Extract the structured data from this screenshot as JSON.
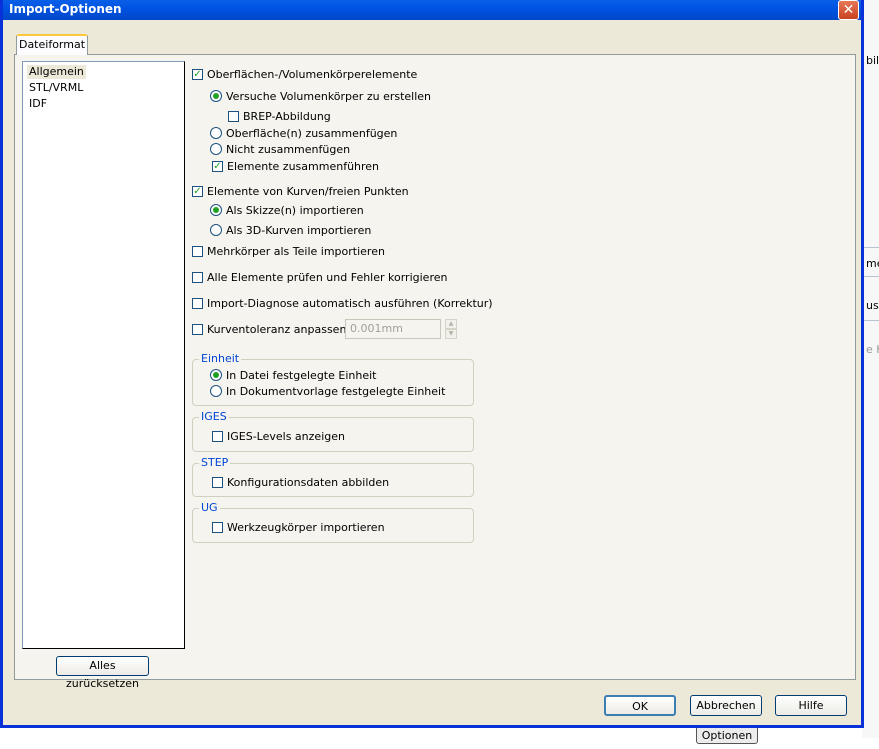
{
  "window": {
    "title": "Import-Optionen",
    "close_glyph": "✕"
  },
  "tabs": [
    {
      "label": "Dateiformat"
    }
  ],
  "sidebar": {
    "items": [
      {
        "label": "Allgemein",
        "selected": true
      },
      {
        "label": "STL/VRML",
        "selected": false
      },
      {
        "label": "IDF",
        "selected": false
      }
    ],
    "reset_button": "Alles zurücksetzen"
  },
  "options": {
    "surfaces": {
      "label": "Oberflächen-/Volumenkörperelemente",
      "checked": true
    },
    "try_solids": {
      "label": "Versuche Volumenkörper zu erstellen",
      "selected": true
    },
    "brep": {
      "label": "BREP-Abbildung",
      "checked": false
    },
    "knit_surfaces": {
      "label": "Oberfläche(n) zusammenfügen",
      "selected": false
    },
    "no_knit": {
      "label": "Nicht zusammenfügen",
      "selected": false
    },
    "merge_entities": {
      "label": "Elemente zusammenführen",
      "checked": true
    },
    "curves": {
      "label": "Elemente von Kurven/freien Punkten",
      "checked": true
    },
    "as_sketches": {
      "label": "Als Skizze(n) importieren",
      "selected": true
    },
    "as_3d_curves": {
      "label": "Als 3D-Kurven importieren",
      "selected": false
    },
    "multibody": {
      "label": "Mehrkörper als Teile importieren",
      "checked": false
    },
    "check_all": {
      "label": "Alle Elemente prüfen und Fehler korrigieren",
      "checked": false
    },
    "import_diag": {
      "label": "Import-Diagnose automatisch ausführen (Korrektur)",
      "checked": false
    },
    "curve_tolerance": {
      "label": "Kurventoleranz anpassen:",
      "checked": false,
      "value": "0.001mm"
    }
  },
  "groups": {
    "units": {
      "legend": "Einheit",
      "file_unit": {
        "label": "In Datei festgelegte Einheit",
        "selected": true
      },
      "template_unit": {
        "label": "In Dokumentvorlage festgelegte Einheit",
        "selected": false
      }
    },
    "iges": {
      "legend": "IGES",
      "show_levels": {
        "label": "IGES-Levels anzeigen",
        "checked": false
      }
    },
    "step": {
      "legend": "STEP",
      "config_data": {
        "label": "Konfigurationsdaten abbilden",
        "checked": false
      }
    },
    "ug": {
      "legend": "UG",
      "tool_bodies": {
        "label": "Werkzeugkörper importieren",
        "checked": false
      }
    }
  },
  "footer": {
    "ok": "OK",
    "cancel": "Abbrechen",
    "help": "Hilfe"
  },
  "background": {
    "frag1": "bild",
    "frag2": "me",
    "frag3": "us |",
    "frag4": "e K",
    "optionen_button": "Optionen"
  },
  "colors": {
    "title_bar": "#0054e3",
    "check_mark": "#21a121",
    "group_legend": "#0046d5",
    "close_button": "#c9421f"
  }
}
